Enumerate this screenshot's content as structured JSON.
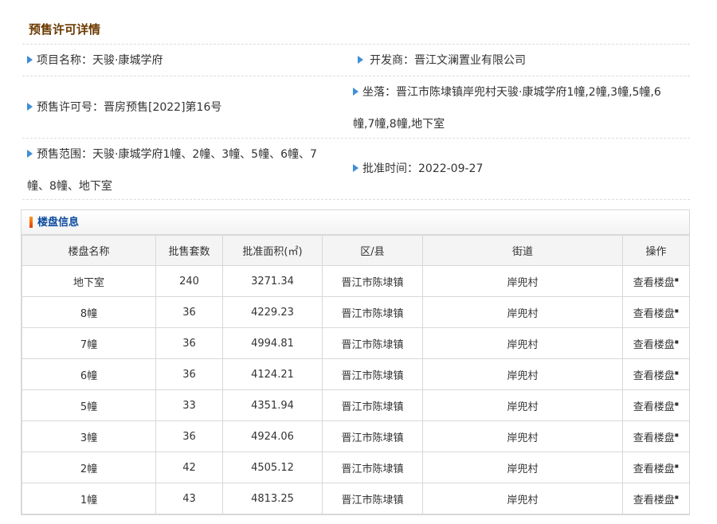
{
  "title": "预售许可详情",
  "details": {
    "project_name": "项目名称：天骏·康城学府",
    "developer": "开发商：晋江文澜置业有限公司",
    "permit_no": "预售许可号：晋房预售[2022]第16号",
    "location_line1": "坐落：晋江市陈埭镇岸兜村天骏·康城学府1幢,2幢,3幢,5幢,6",
    "location_line2": "幢,7幢,8幢,地下室",
    "scope_line1": "预售范围：天骏·康城学府1幢、2幢、3幢、5幢、6幢、7",
    "scope_line2": "幢、8幢、地下室",
    "approval_time": "批准时间：2022-09-27"
  },
  "building_panel": {
    "title": "楼盘信息",
    "columns": [
      "楼盘名称",
      "批售套数",
      "批准面积(㎡)",
      "区/县",
      "街道",
      "操作"
    ],
    "action_label": "查看楼盘",
    "rows": [
      {
        "name": "地下室",
        "units": "240",
        "area": "3271.34",
        "district": "晋江市陈埭镇",
        "street": "岸兜村"
      },
      {
        "name": "8幢",
        "units": "36",
        "area": "4229.23",
        "district": "晋江市陈埭镇",
        "street": "岸兜村"
      },
      {
        "name": "7幢",
        "units": "36",
        "area": "4994.81",
        "district": "晋江市陈埭镇",
        "street": "岸兜村"
      },
      {
        "name": "6幢",
        "units": "36",
        "area": "4124.21",
        "district": "晋江市陈埭镇",
        "street": "岸兜村"
      },
      {
        "name": "5幢",
        "units": "33",
        "area": "4351.94",
        "district": "晋江市陈埭镇",
        "street": "岸兜村"
      },
      {
        "name": "3幢",
        "units": "36",
        "area": "4924.06",
        "district": "晋江市陈埭镇",
        "street": "岸兜村"
      },
      {
        "name": "2幢",
        "units": "42",
        "area": "4505.12",
        "district": "晋江市陈埭镇",
        "street": "岸兜村"
      },
      {
        "name": "1幢",
        "units": "43",
        "area": "4813.25",
        "district": "晋江市陈埭镇",
        "street": "岸兜村"
      }
    ]
  }
}
